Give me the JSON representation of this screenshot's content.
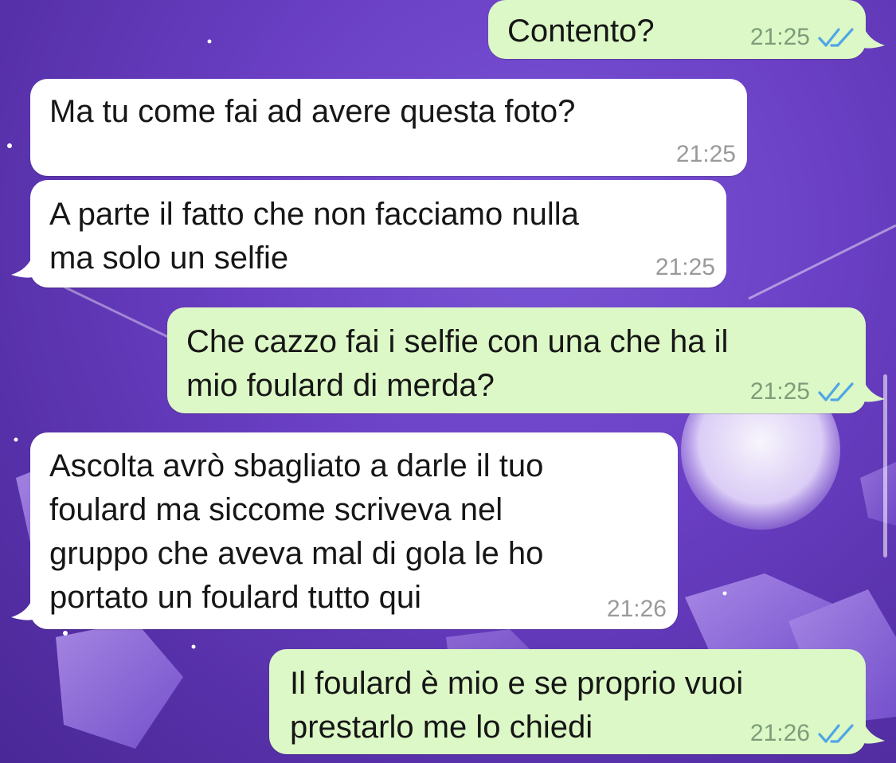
{
  "colors": {
    "incoming_bubble": "#ffffff",
    "outgoing_bubble": "#dcf8c6",
    "read_ticks": "#4fa6e6",
    "wallpaper": "#6a3fc4"
  },
  "icons": {
    "read_receipt": "double-check-icon"
  },
  "messages": [
    {
      "direction": "outgoing",
      "lines": [
        "Contento?"
      ],
      "time": "21:25",
      "status": "read"
    },
    {
      "direction": "incoming",
      "lines": [
        "Ma tu come fai ad avere questa foto?"
      ],
      "time": "21:25"
    },
    {
      "direction": "incoming",
      "lines": [
        "A parte il fatto che non facciamo nulla",
        "ma solo un selfie"
      ],
      "time": "21:25"
    },
    {
      "direction": "outgoing",
      "lines": [
        "Che cazzo fai i selfie con una che ha il",
        "mio foulard di merda?"
      ],
      "time": "21:25",
      "status": "read"
    },
    {
      "direction": "incoming",
      "lines": [
        "Ascolta avrò sbagliato a darle il tuo",
        "foulard ma siccome scriveva nel",
        "gruppo che aveva mal di gola le ho",
        "portato un foulard tutto qui"
      ],
      "time": "21:26"
    },
    {
      "direction": "outgoing",
      "lines": [
        "Il foulard è mio e se proprio vuoi",
        "prestarlo me lo chiedi"
      ],
      "time": "21:26",
      "status": "read"
    }
  ]
}
